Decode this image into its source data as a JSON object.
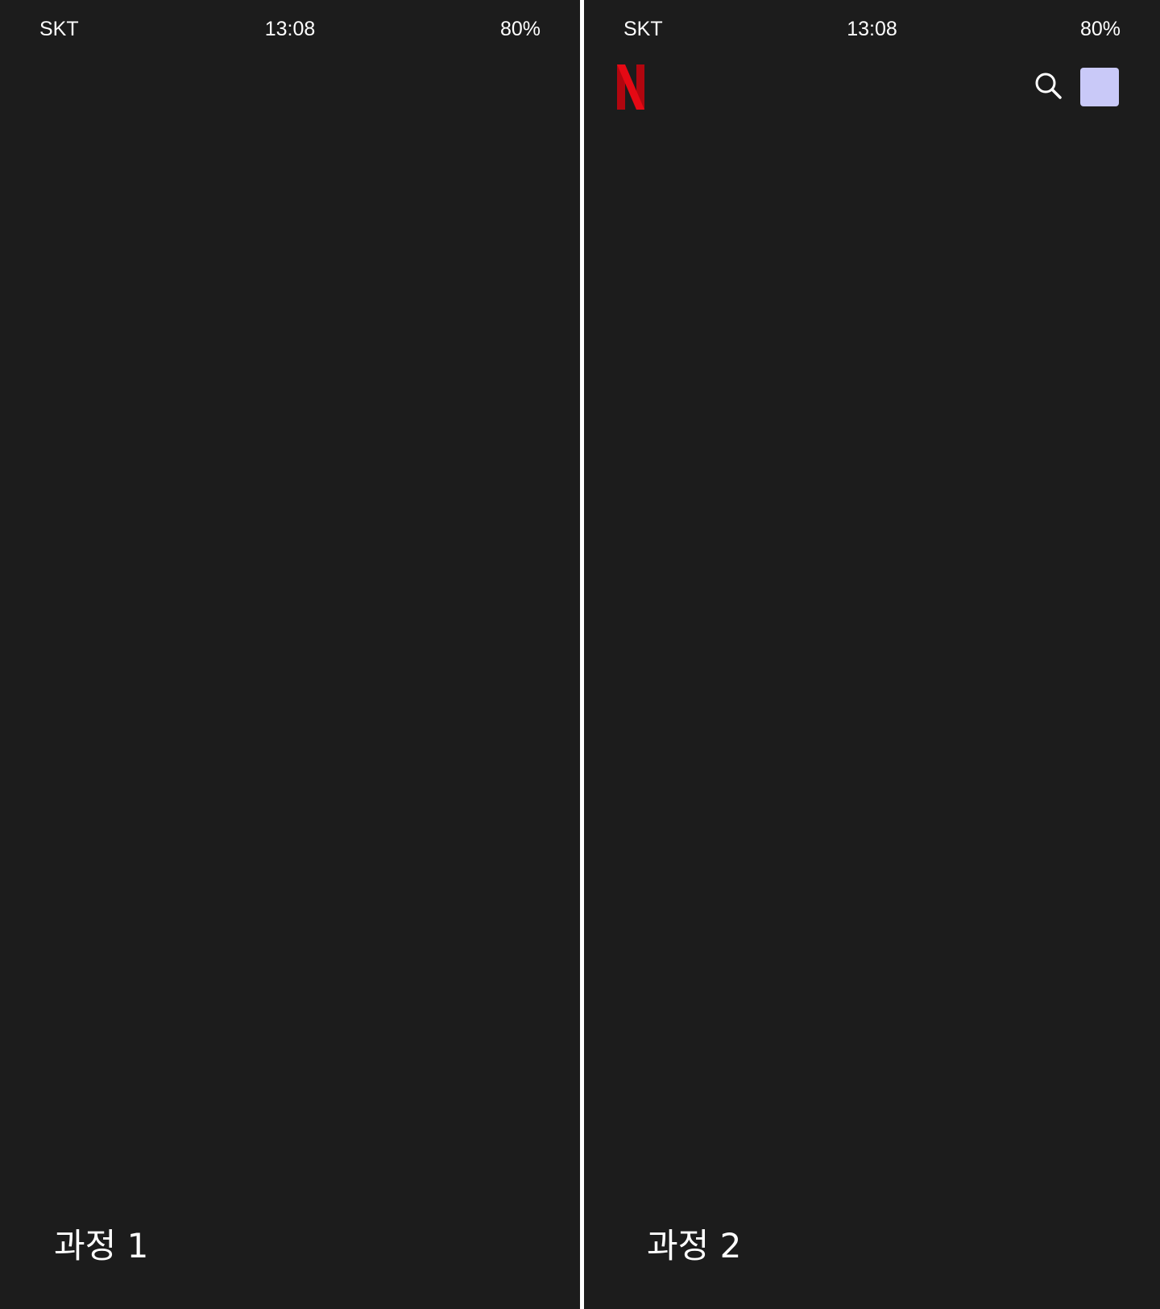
{
  "panels": [
    {
      "status_bar": {
        "carrier": "SKT",
        "time": "13:08",
        "battery": "80%"
      },
      "step_label": "과정 1"
    },
    {
      "status_bar": {
        "carrier": "SKT",
        "time": "13:08",
        "battery": "80%"
      },
      "header": {
        "logo": "N",
        "logo_color": "#e50914",
        "search_icon": "search-icon",
        "avatar_color": "#c9c9f8"
      },
      "step_label": "과정 2"
    }
  ]
}
